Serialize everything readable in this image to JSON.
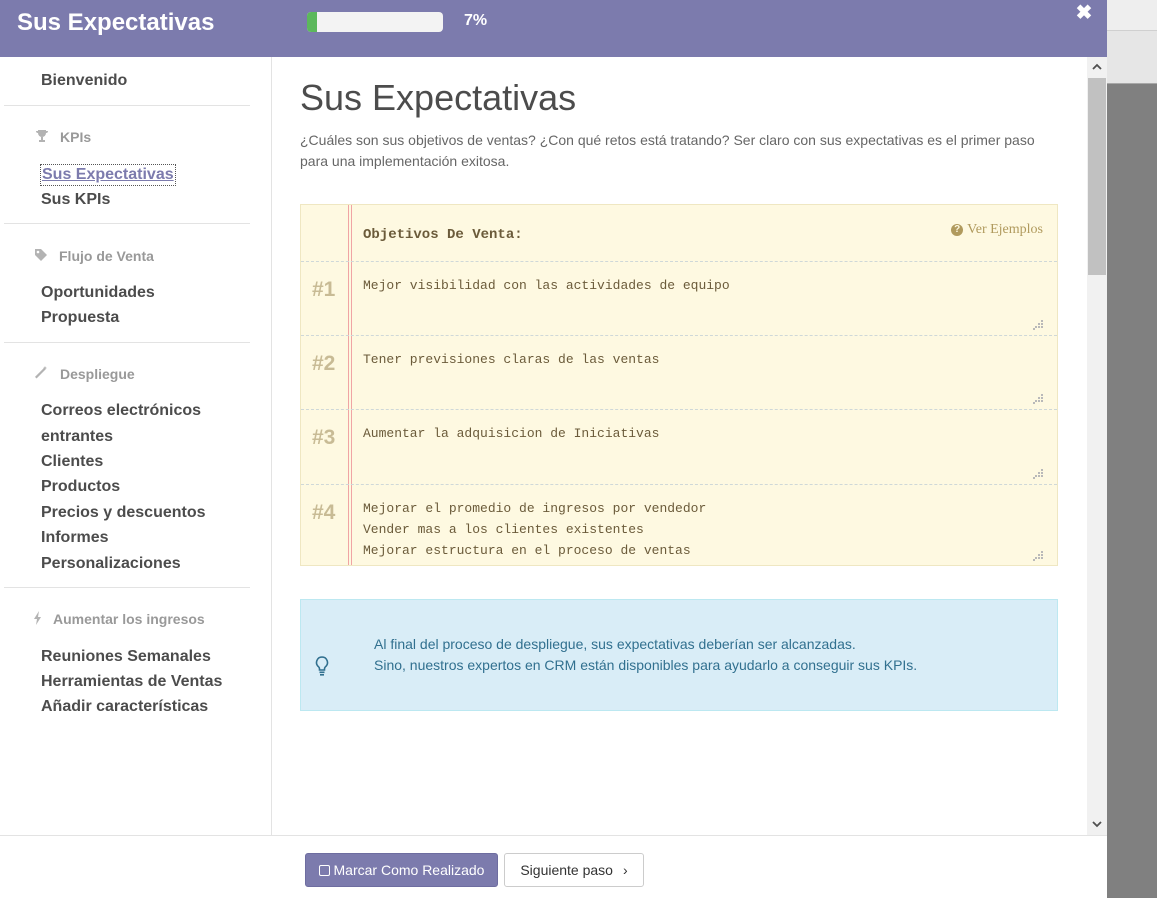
{
  "header": {
    "title": "Sus Expectativas",
    "progress_percent": 7,
    "progress_label": "7%",
    "close_icon": "close-icon"
  },
  "sidebar": {
    "welcome": "Bienvenido",
    "sections": [
      {
        "title": "KPIs",
        "icon": "trophy-icon",
        "items": [
          "Sus Expectativas",
          "Sus KPIs"
        ]
      },
      {
        "title": "Flujo de Venta",
        "icon": "tag-icon",
        "items": [
          "Oportunidades",
          "Propuesta"
        ]
      },
      {
        "title": "Despliegue",
        "icon": "magic-wand-icon",
        "items": [
          "Correos electrónicos",
          "entrantes",
          "Clientes",
          "Productos",
          "Precios y descuentos",
          "Informes",
          "Personalizaciones"
        ]
      },
      {
        "title": "Aumentar los ingresos",
        "icon": "bolt-icon",
        "items": [
          "Reuniones Semanales",
          "Herramientas de Ventas",
          "Añadir características"
        ]
      }
    ],
    "active_item": "Sus Expectativas"
  },
  "main": {
    "title": "Sus Expectativas",
    "lead": "¿Cuáles son sus objetivos de ventas? ¿Con qué retos está tratando? Ser claro con sus expectativas es el primer paso para una implementación exitosa.",
    "notebook": {
      "title": "Objetivos De Venta:",
      "examples_link": "Ver Ejemplos",
      "rows": [
        {
          "num": "#1",
          "text": "Mejor visibilidad con las actividades de equipo"
        },
        {
          "num": "#2",
          "text": "Tener previsiones claras de las ventas"
        },
        {
          "num": "#3",
          "text": "Aumentar la adquisicion de Iniciativas"
        },
        {
          "num": "#4",
          "text": "Mejorar el promedio de ingresos por vendedor\nVender mas a los clientes existentes\nMejorar estructura en el proceso de ventas"
        }
      ]
    },
    "alert": {
      "icon": "lightbulb-icon",
      "line1": "Al final del proceso de despliegue, sus expectativas deberían ser alcanzadas.",
      "line2": "Sino, nuestros expertos en CRM están disponibles para ayudarlo a conseguir sus KPIs."
    }
  },
  "footer": {
    "done_label": "Marcar Como Realizado",
    "next_label": "Siguiente paso"
  },
  "colors": {
    "brand": "#7c7bad",
    "progress_fill": "#5cb85c",
    "notebook_bg": "#fef9e1",
    "alert_bg": "#d9edf7",
    "alert_text": "#31708f"
  }
}
